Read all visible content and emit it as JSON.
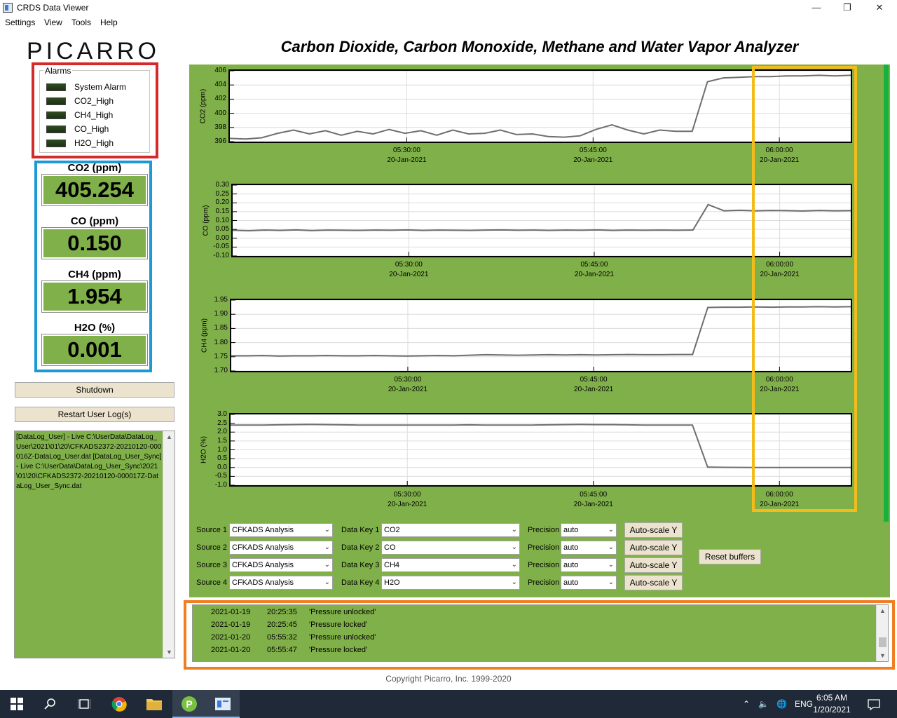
{
  "window": {
    "title": "CRDS Data Viewer",
    "minimize": "—",
    "restore": "❐",
    "close": "✕"
  },
  "menu": [
    "Settings",
    "View",
    "Tools",
    "Help"
  ],
  "logo": "PICARRO",
  "alarms": {
    "label": "Alarms",
    "items": [
      "System Alarm",
      "CO2_High",
      "CH4_High",
      "CO_High",
      "H2O_High"
    ]
  },
  "readings": [
    {
      "label": "CO2 (ppm)",
      "value": "405.254"
    },
    {
      "label": "CO (ppm)",
      "value": "0.150"
    },
    {
      "label": "CH4 (ppm)",
      "value": "1.954"
    },
    {
      "label": "H2O (%)",
      "value": "0.001"
    }
  ],
  "buttons": {
    "shutdown": "Shutdown",
    "restart_log": "Restart User Log(s)",
    "reset_buffers": "Reset buffers",
    "autoscale": "Auto-scale Y"
  },
  "user_log": "[DataLog_User] - Live C:\\UserData\\DataLog_User\\2021\\01\\20\\CFKADS2372-20210120-000016Z-DataLog_User.dat [DataLog_User_Sync] - Live C:\\UserData\\DataLog_User_Sync\\2021\\01\\20\\CFKADS2372-20210120-000017Z-DataLog_User_Sync.dat",
  "main_title": "Carbon Dioxide, Carbon Monoxide, Methane and Water Vapor Analyzer",
  "chart_data": [
    {
      "type": "line",
      "ylabel": "CO2 (ppm)",
      "yticks": [
        "406",
        "404",
        "402",
        "400",
        "398",
        "396"
      ],
      "ylim": [
        395,
        406
      ],
      "xticks": [
        [
          "05:30:00",
          "20-Jan-2021"
        ],
        [
          "05:45:00",
          "20-Jan-2021"
        ],
        [
          "06:00:00",
          "20-Jan-2021"
        ]
      ],
      "grid": true,
      "series": [
        {
          "values": [
            395.5,
            395.4,
            395.6,
            396.3,
            396.8,
            396.2,
            396.7,
            396.0,
            396.6,
            396.2,
            396.9,
            396.3,
            396.7,
            396.0,
            396.8,
            396.2,
            396.3,
            396.8,
            396.1,
            396.2,
            395.8,
            395.7,
            395.9,
            396.9,
            397.6,
            396.8,
            396.2,
            396.8,
            396.6,
            396.6,
            404.3,
            404.9,
            405.0,
            405.1,
            405.1,
            405.2,
            405.2,
            405.3,
            405.2,
            405.3
          ]
        }
      ]
    },
    {
      "type": "line",
      "ylabel": "CO (ppm)",
      "yticks": [
        "0.30",
        "0.25",
        "0.20",
        "0.15",
        "0.10",
        "0.05",
        "0.00",
        "-0.05",
        "-0.10"
      ],
      "ylim": [
        -0.1,
        0.3
      ],
      "xticks": [
        [
          "05:30:00",
          "20-Jan-2021"
        ],
        [
          "05:45:00",
          "20-Jan-2021"
        ],
        [
          "06:00:00",
          "20-Jan-2021"
        ]
      ],
      "grid": true,
      "series": [
        {
          "values": [
            0.045,
            0.042,
            0.046,
            0.044,
            0.047,
            0.043,
            0.046,
            0.045,
            0.044,
            0.046,
            0.045,
            0.047,
            0.044,
            0.046,
            0.045,
            0.044,
            0.046,
            0.047,
            0.045,
            0.046,
            0.044,
            0.046,
            0.045,
            0.047,
            0.044,
            0.046,
            0.045,
            0.046,
            0.045,
            0.046,
            0.19,
            0.155,
            0.158,
            0.155,
            0.157,
            0.156,
            0.154,
            0.157,
            0.155,
            0.156
          ]
        }
      ]
    },
    {
      "type": "line",
      "ylabel": "CH4 (ppm)",
      "yticks": [
        "1.95",
        "1.90",
        "1.85",
        "1.80",
        "1.75",
        "1.70"
      ],
      "ylim": [
        1.7,
        1.98
      ],
      "xticks": [
        [
          "05:30:00",
          "20-Jan-2021"
        ],
        [
          "05:45:00",
          "20-Jan-2021"
        ],
        [
          "06:00:00",
          "20-Jan-2021"
        ]
      ],
      "grid": true,
      "series": [
        {
          "values": [
            1.76,
            1.76,
            1.761,
            1.759,
            1.76,
            1.76,
            1.761,
            1.76,
            1.76,
            1.761,
            1.76,
            1.759,
            1.76,
            1.761,
            1.76,
            1.762,
            1.764,
            1.763,
            1.762,
            1.763,
            1.764,
            1.763,
            1.764,
            1.763,
            1.764,
            1.765,
            1.764,
            1.764,
            1.765,
            1.765,
            1.951,
            1.952,
            1.952,
            1.953,
            1.952,
            1.953,
            1.953,
            1.954,
            1.953,
            1.954
          ]
        }
      ]
    },
    {
      "type": "line",
      "ylabel": "H2O (%)",
      "yticks": [
        "3.0",
        "2.5",
        "2.0",
        "1.5",
        "1.0",
        "0.5",
        "0.0",
        "-0.5",
        "-1.0"
      ],
      "ylim": [
        -1.0,
        3.0
      ],
      "xticks": [
        [
          "05:30:00",
          "20-Jan-2021"
        ],
        [
          "05:45:00",
          "20-Jan-2021"
        ],
        [
          "06:00:00",
          "20-Jan-2021"
        ]
      ],
      "grid": true,
      "series": [
        {
          "values": [
            2.4,
            2.4,
            2.4,
            2.41,
            2.42,
            2.43,
            2.42,
            2.41,
            2.4,
            2.4,
            2.4,
            2.4,
            2.4,
            2.4,
            2.4,
            2.41,
            2.4,
            2.4,
            2.4,
            2.4,
            2.41,
            2.42,
            2.43,
            2.42,
            2.42,
            2.41,
            2.4,
            2.4,
            2.4,
            2.4,
            0.02,
            0.01,
            0.005,
            0.003,
            0.002,
            0.001,
            0.001,
            0.001,
            0.001,
            0.001
          ]
        }
      ]
    }
  ],
  "controls": {
    "rows": [
      {
        "source_label": "Source 1",
        "source": "CFKADS Analysis",
        "key_label": "Data Key 1",
        "key": "CO2",
        "precision_label": "Precision",
        "precision": "auto"
      },
      {
        "source_label": "Source 2",
        "source": "CFKADS Analysis",
        "key_label": "Data Key 2",
        "key": "CO",
        "precision_label": "Precision",
        "precision": "auto"
      },
      {
        "source_label": "Source 3",
        "source": "CFKADS Analysis",
        "key_label": "Data Key 3",
        "key": "CH4",
        "precision_label": "Precision",
        "precision": "auto"
      },
      {
        "source_label": "Source 4",
        "source": "CFKADS Analysis",
        "key_label": "Data Key 4",
        "key": "H2O",
        "precision_label": "Precision",
        "precision": "auto"
      }
    ]
  },
  "events": [
    {
      "date": "2021-01-19",
      "time": "20:25:35",
      "msg": "'Pressure unlocked'"
    },
    {
      "date": "2021-01-19",
      "time": "20:25:45",
      "msg": "'Pressure locked'"
    },
    {
      "date": "2021-01-20",
      "time": "05:55:32",
      "msg": "'Pressure unlocked'"
    },
    {
      "date": "2021-01-20",
      "time": "05:55:47",
      "msg": "'Pressure locked'"
    }
  ],
  "copyright": "Copyright Picarro, Inc. 1999-2020",
  "taskbar": {
    "lang": "ENG",
    "time": "6:05 AM",
    "date": "1/20/2021"
  },
  "colors": {
    "panel_green": "#80b049",
    "alarm_red": "#d42a2a",
    "readings_blue": "#1c9ad6",
    "recent_gold": "#f3bc1a",
    "events_orange": "#f07f23",
    "status_green": "#16b33c"
  }
}
